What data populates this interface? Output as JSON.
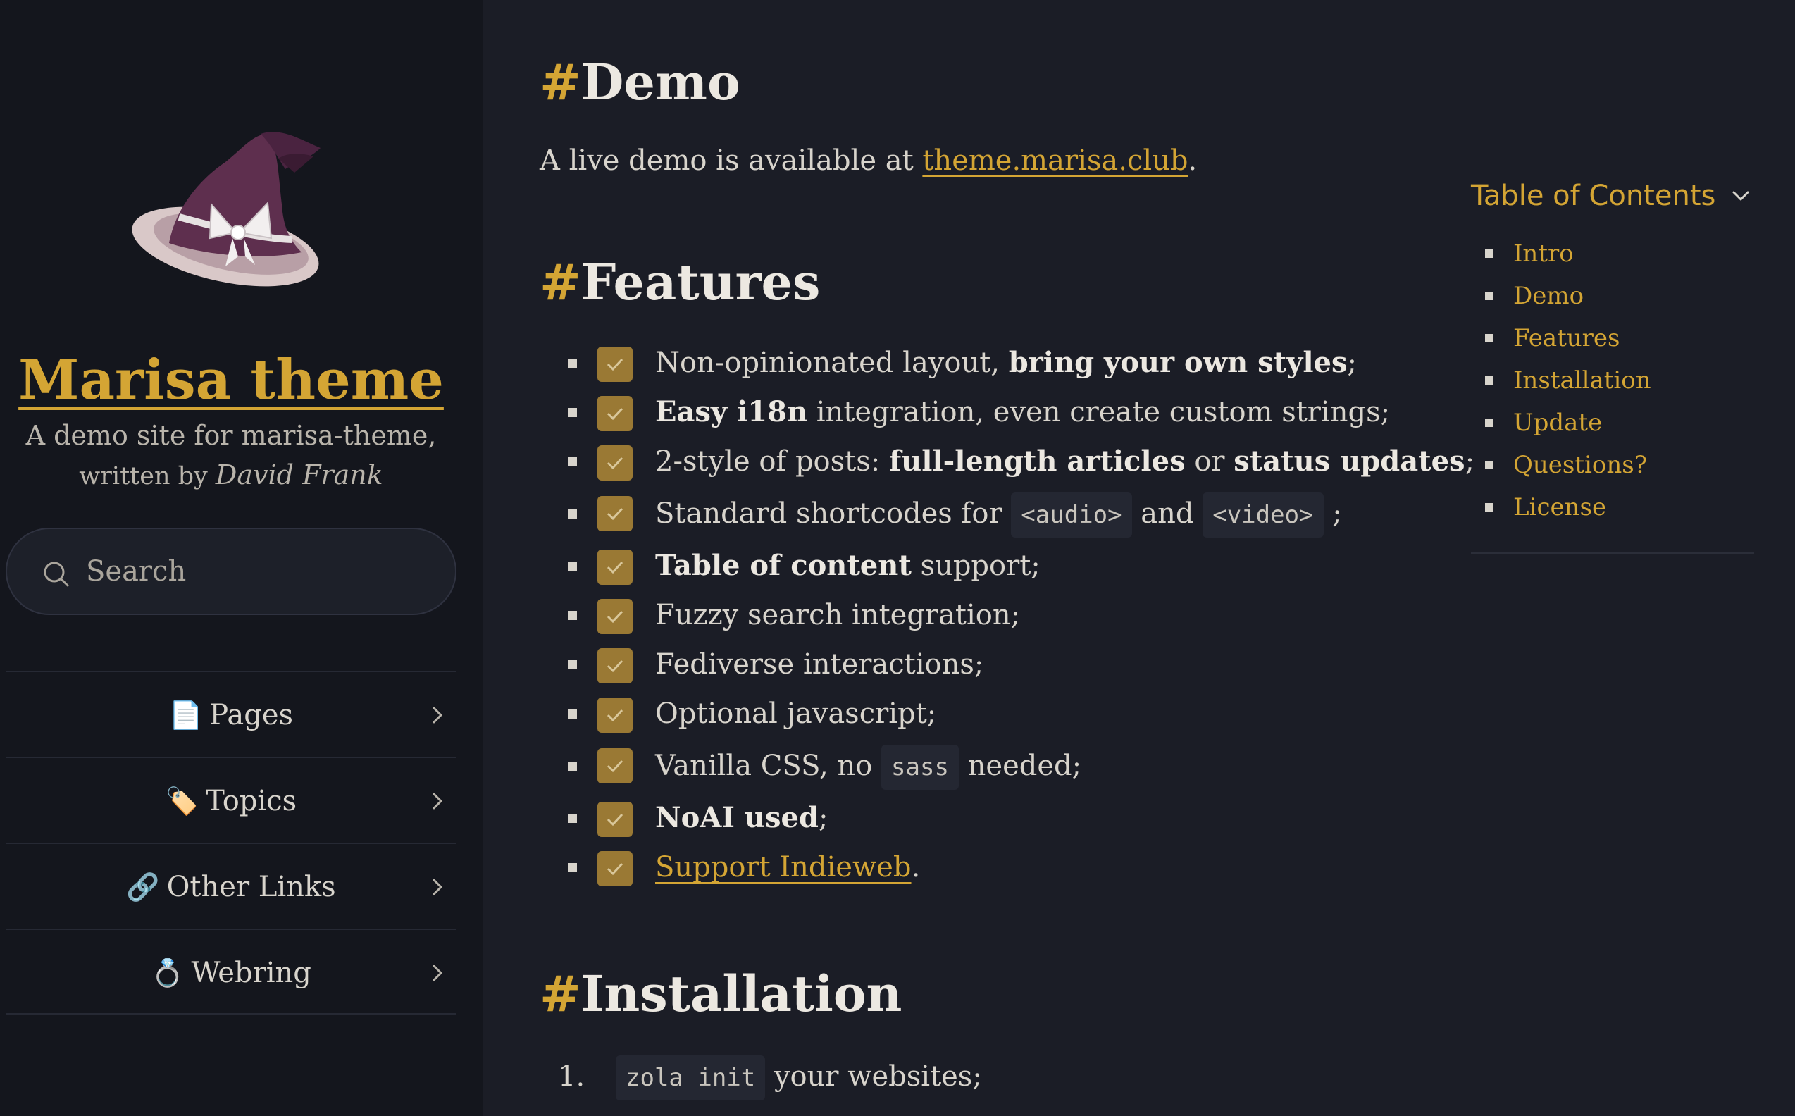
{
  "sidebar": {
    "title": "Marisa theme",
    "desc_line1": "A demo site for marisa-theme,",
    "desc_line2_prefix": "written by ",
    "desc_author": "David Frank",
    "search": {
      "placeholder": "Search"
    },
    "nav": [
      {
        "emoji": "📄",
        "label": "Pages"
      },
      {
        "emoji": "🏷️",
        "label": "Topics"
      },
      {
        "emoji": "🔗",
        "label": "Other Links"
      },
      {
        "emoji": "💍",
        "label": "Webring"
      }
    ]
  },
  "main": {
    "demo": {
      "hash": "#",
      "heading": "Demo",
      "text_before": "A live demo is available at ",
      "link": "theme.marisa.club",
      "text_after": "."
    },
    "features": {
      "hash": "#",
      "heading": "Features",
      "items": [
        {
          "t1": "Non-opinionated layout, ",
          "b1": "bring your own styles",
          "t2": ";"
        },
        {
          "b1": "Easy i18n",
          "t1": " integration, even create custom strings;"
        },
        {
          "t1": "2-style of posts: ",
          "b1": "full-length articles",
          "t2": " or ",
          "b2": "status updates",
          "t3": ";"
        },
        {
          "t1": "Standard shortcodes for ",
          "c1": "<audio>",
          "t2": " and ",
          "c2": "<video>",
          "t3": " ;"
        },
        {
          "b1": "Table of content",
          "t1": " support;"
        },
        {
          "t1": "Fuzzy search integration;"
        },
        {
          "t1": "Fediverse interactions;"
        },
        {
          "t1": "Optional javascript;"
        },
        {
          "t1": "Vanilla CSS, no ",
          "c1": "sass",
          "t2": " needed;"
        },
        {
          "b1": "NoAI used",
          "t1": ";"
        },
        {
          "link": "Support Indieweb",
          "t1": "."
        }
      ]
    },
    "installation": {
      "hash": "#",
      "heading": "Installation",
      "items": [
        {
          "num": "1.",
          "code": "zola init",
          "text": " your websites;"
        }
      ]
    }
  },
  "toc": {
    "title": "Table of Contents",
    "items": [
      "Intro",
      "Demo",
      "Features",
      "Installation",
      "Update",
      "Questions?",
      "License"
    ]
  },
  "colors": {
    "accent": "#d4a534",
    "background": "#1b1d26",
    "sidebar_bg": "#14161d",
    "checkbox": "#9a7934"
  }
}
